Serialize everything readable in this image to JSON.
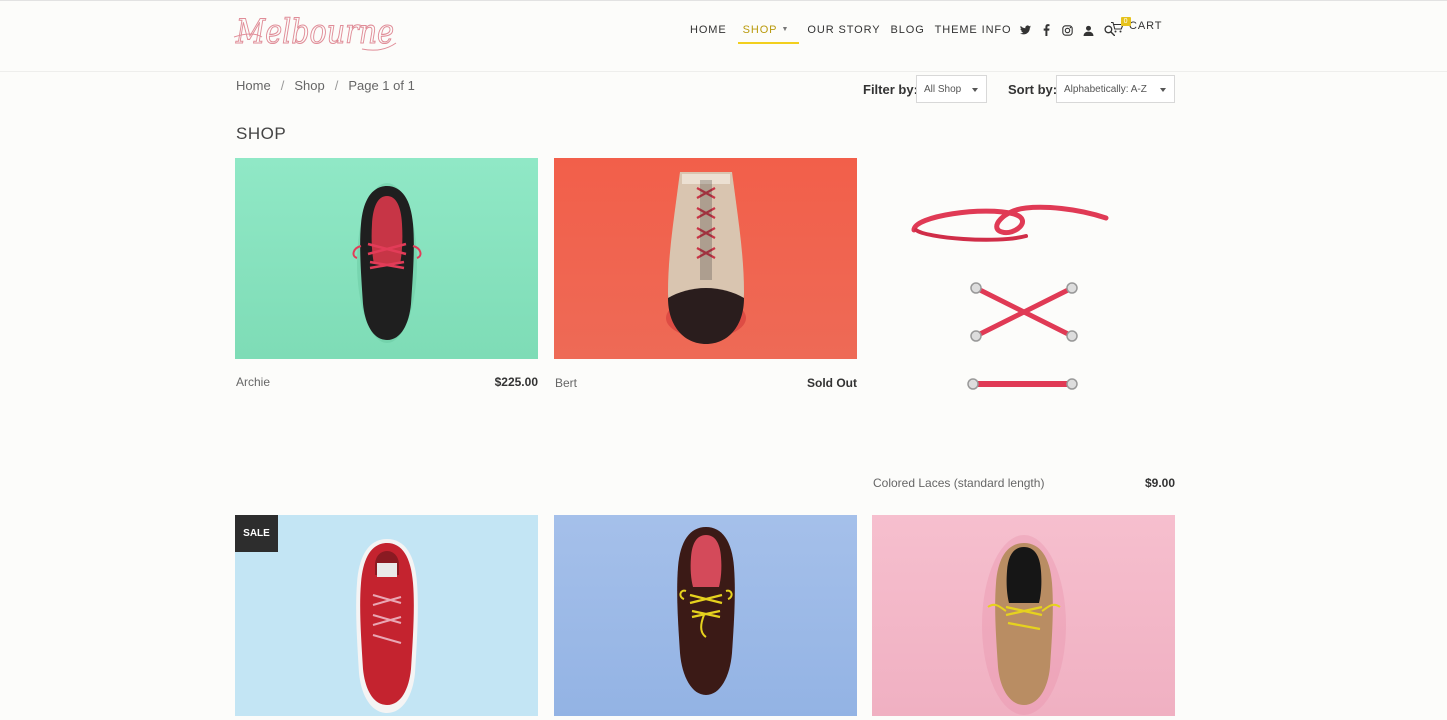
{
  "brand": {
    "logo_text": "Melbourne"
  },
  "nav": {
    "home": "HOME",
    "shop": "SHOP",
    "our_story": "OUR STORY",
    "blog": "BLOG",
    "theme_info": "THEME INFO",
    "cart": "CART",
    "cart_count": "0"
  },
  "breadcrumb": {
    "home": "Home",
    "shop": "Shop",
    "page": "Page 1 of 1",
    "separator": "/"
  },
  "filter": {
    "label": "Filter by:",
    "value": "All Shop"
  },
  "sort": {
    "label": "Sort by:",
    "value": "Alphabetically: A-Z"
  },
  "page_title": "SHOP",
  "products": [
    {
      "name": "Archie",
      "price": "$225.00",
      "bg": "#8ee6c4"
    },
    {
      "name": "Bert",
      "price": "Sold Out",
      "bg": "#f0604a"
    },
    {
      "name": "Colored Laces (standard length)",
      "price": "$9.00",
      "bg": "#fcfcfa"
    },
    {
      "badge": "SALE",
      "bg": "#bfe3f3"
    },
    {
      "bg": "#9dbbe8"
    },
    {
      "bg": "#f3b8c8"
    }
  ],
  "colors": {
    "accent": "#f2cf1d",
    "lace_red": "#e03a55",
    "lace_yellow": "#e6d21e"
  }
}
